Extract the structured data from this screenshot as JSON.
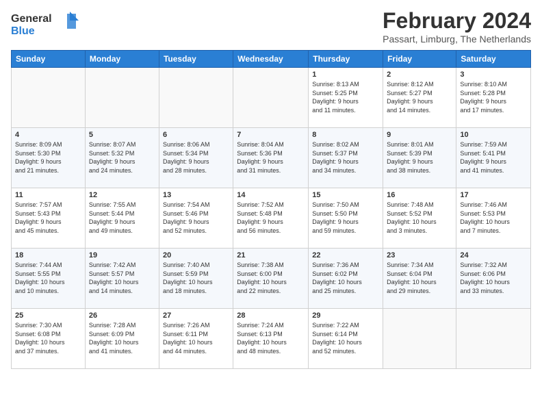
{
  "header": {
    "logo_line1": "General",
    "logo_line2": "Blue",
    "month_title": "February 2024",
    "location": "Passart, Limburg, The Netherlands"
  },
  "days_of_week": [
    "Sunday",
    "Monday",
    "Tuesday",
    "Wednesday",
    "Thursday",
    "Friday",
    "Saturday"
  ],
  "weeks": [
    [
      {
        "day": "",
        "info": ""
      },
      {
        "day": "",
        "info": ""
      },
      {
        "day": "",
        "info": ""
      },
      {
        "day": "",
        "info": ""
      },
      {
        "day": "1",
        "info": "Sunrise: 8:13 AM\nSunset: 5:25 PM\nDaylight: 9 hours\nand 11 minutes."
      },
      {
        "day": "2",
        "info": "Sunrise: 8:12 AM\nSunset: 5:27 PM\nDaylight: 9 hours\nand 14 minutes."
      },
      {
        "day": "3",
        "info": "Sunrise: 8:10 AM\nSunset: 5:28 PM\nDaylight: 9 hours\nand 17 minutes."
      }
    ],
    [
      {
        "day": "4",
        "info": "Sunrise: 8:09 AM\nSunset: 5:30 PM\nDaylight: 9 hours\nand 21 minutes."
      },
      {
        "day": "5",
        "info": "Sunrise: 8:07 AM\nSunset: 5:32 PM\nDaylight: 9 hours\nand 24 minutes."
      },
      {
        "day": "6",
        "info": "Sunrise: 8:06 AM\nSunset: 5:34 PM\nDaylight: 9 hours\nand 28 minutes."
      },
      {
        "day": "7",
        "info": "Sunrise: 8:04 AM\nSunset: 5:36 PM\nDaylight: 9 hours\nand 31 minutes."
      },
      {
        "day": "8",
        "info": "Sunrise: 8:02 AM\nSunset: 5:37 PM\nDaylight: 9 hours\nand 34 minutes."
      },
      {
        "day": "9",
        "info": "Sunrise: 8:01 AM\nSunset: 5:39 PM\nDaylight: 9 hours\nand 38 minutes."
      },
      {
        "day": "10",
        "info": "Sunrise: 7:59 AM\nSunset: 5:41 PM\nDaylight: 9 hours\nand 41 minutes."
      }
    ],
    [
      {
        "day": "11",
        "info": "Sunrise: 7:57 AM\nSunset: 5:43 PM\nDaylight: 9 hours\nand 45 minutes."
      },
      {
        "day": "12",
        "info": "Sunrise: 7:55 AM\nSunset: 5:44 PM\nDaylight: 9 hours\nand 49 minutes."
      },
      {
        "day": "13",
        "info": "Sunrise: 7:54 AM\nSunset: 5:46 PM\nDaylight: 9 hours\nand 52 minutes."
      },
      {
        "day": "14",
        "info": "Sunrise: 7:52 AM\nSunset: 5:48 PM\nDaylight: 9 hours\nand 56 minutes."
      },
      {
        "day": "15",
        "info": "Sunrise: 7:50 AM\nSunset: 5:50 PM\nDaylight: 9 hours\nand 59 minutes."
      },
      {
        "day": "16",
        "info": "Sunrise: 7:48 AM\nSunset: 5:52 PM\nDaylight: 10 hours\nand 3 minutes."
      },
      {
        "day": "17",
        "info": "Sunrise: 7:46 AM\nSunset: 5:53 PM\nDaylight: 10 hours\nand 7 minutes."
      }
    ],
    [
      {
        "day": "18",
        "info": "Sunrise: 7:44 AM\nSunset: 5:55 PM\nDaylight: 10 hours\nand 10 minutes."
      },
      {
        "day": "19",
        "info": "Sunrise: 7:42 AM\nSunset: 5:57 PM\nDaylight: 10 hours\nand 14 minutes."
      },
      {
        "day": "20",
        "info": "Sunrise: 7:40 AM\nSunset: 5:59 PM\nDaylight: 10 hours\nand 18 minutes."
      },
      {
        "day": "21",
        "info": "Sunrise: 7:38 AM\nSunset: 6:00 PM\nDaylight: 10 hours\nand 22 minutes."
      },
      {
        "day": "22",
        "info": "Sunrise: 7:36 AM\nSunset: 6:02 PM\nDaylight: 10 hours\nand 25 minutes."
      },
      {
        "day": "23",
        "info": "Sunrise: 7:34 AM\nSunset: 6:04 PM\nDaylight: 10 hours\nand 29 minutes."
      },
      {
        "day": "24",
        "info": "Sunrise: 7:32 AM\nSunset: 6:06 PM\nDaylight: 10 hours\nand 33 minutes."
      }
    ],
    [
      {
        "day": "25",
        "info": "Sunrise: 7:30 AM\nSunset: 6:08 PM\nDaylight: 10 hours\nand 37 minutes."
      },
      {
        "day": "26",
        "info": "Sunrise: 7:28 AM\nSunset: 6:09 PM\nDaylight: 10 hours\nand 41 minutes."
      },
      {
        "day": "27",
        "info": "Sunrise: 7:26 AM\nSunset: 6:11 PM\nDaylight: 10 hours\nand 44 minutes."
      },
      {
        "day": "28",
        "info": "Sunrise: 7:24 AM\nSunset: 6:13 PM\nDaylight: 10 hours\nand 48 minutes."
      },
      {
        "day": "29",
        "info": "Sunrise: 7:22 AM\nSunset: 6:14 PM\nDaylight: 10 hours\nand 52 minutes."
      },
      {
        "day": "",
        "info": ""
      },
      {
        "day": "",
        "info": ""
      }
    ]
  ]
}
